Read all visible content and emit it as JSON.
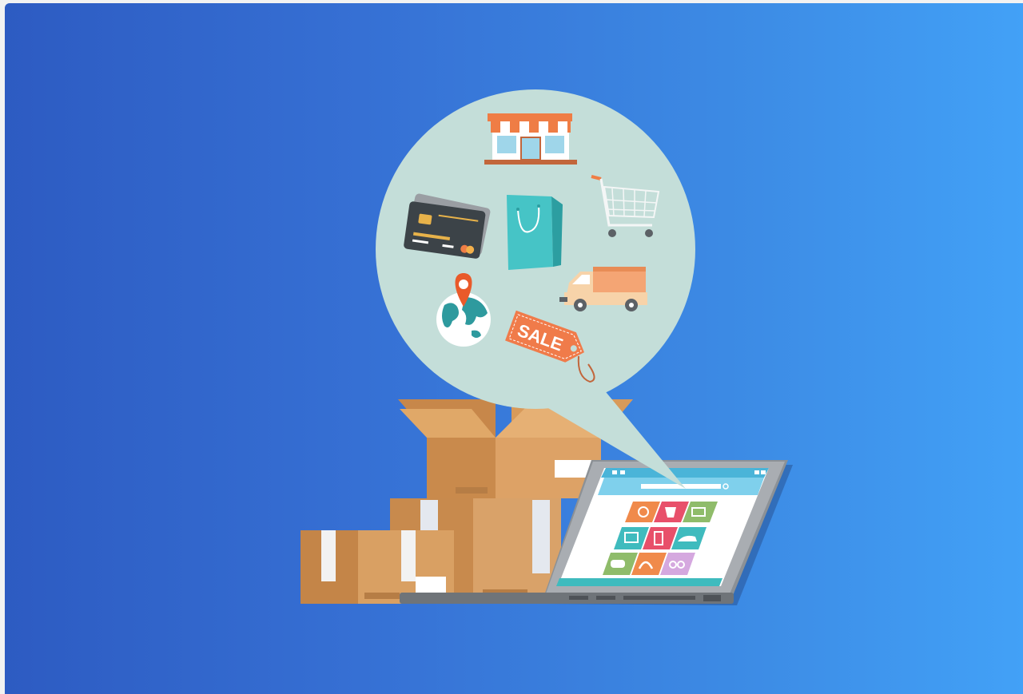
{
  "illustration": {
    "sale_tag_text": "SALE",
    "icons": [
      "storefront-icon",
      "credit-cards-icon",
      "shopping-bag-icon",
      "shopping-cart-icon",
      "delivery-truck-icon",
      "globe-location-icon",
      "sale-tag-icon",
      "cardboard-boxes",
      "laptop-icon"
    ],
    "colors": {
      "background_start": "#2d5bc2",
      "background_end": "#42a1f7",
      "bubble": "#c4ded9",
      "box": "#d39b5c",
      "accent_orange": "#f07b4a",
      "teal": "#3fbbbe"
    }
  }
}
